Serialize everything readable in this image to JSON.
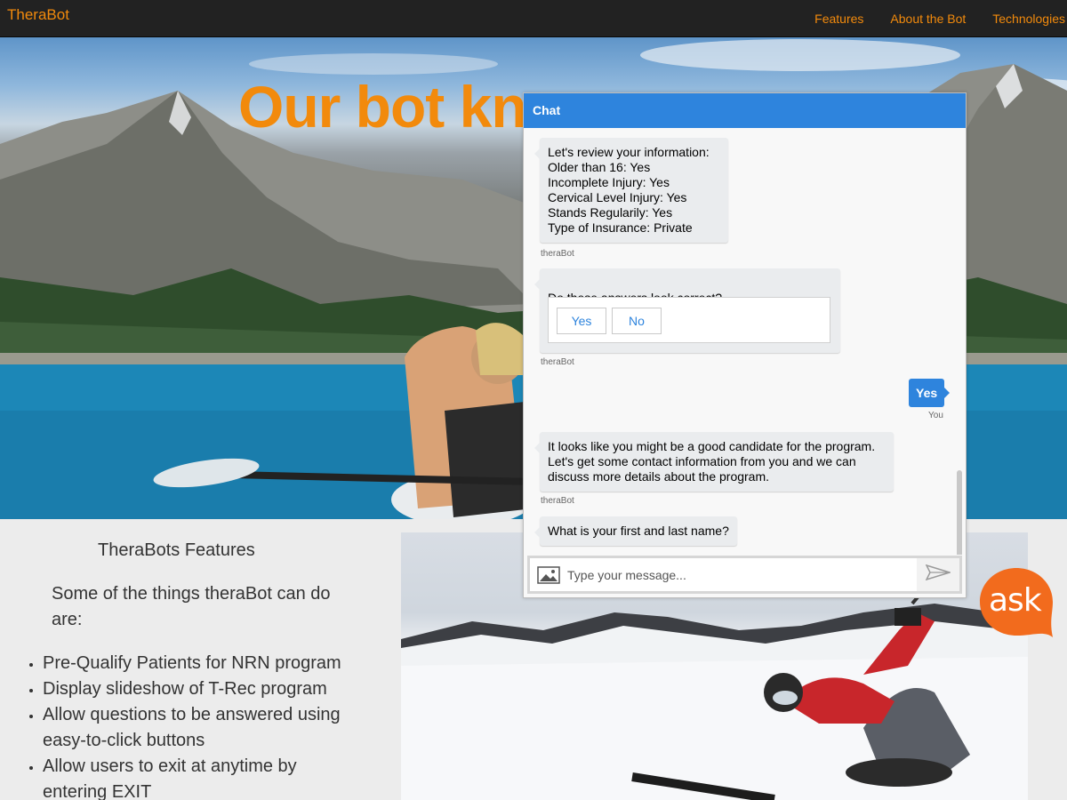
{
  "navbar": {
    "brand": "TheraBot",
    "links": [
      "Features",
      "About the Bot",
      "Technologies"
    ]
  },
  "hero": {
    "title": "Our bot kno"
  },
  "features": {
    "title": "TheraBots Features",
    "intro": "Some of the things theraBot can do are:",
    "items": [
      "Pre-Qualify Patients for NRN program",
      "Display slideshow of T-Rec program",
      "Allow questions to be answered using easy-to-click buttons",
      "Allow users to exit at anytime by entering EXIT"
    ]
  },
  "chat": {
    "header": "Chat",
    "messages": [
      {
        "from": "bot",
        "text": "Let's review your information:\nOlder than 16: Yes\nIncomplete Injury: Yes\nCervical Level Injury: Yes\nStands Regularily: Yes\nType of Insurance: Private",
        "sender": "theraBot"
      },
      {
        "from": "bot",
        "text": "Do these answers look correct?",
        "buttons": [
          "Yes",
          "No"
        ],
        "sender": "theraBot"
      },
      {
        "from": "user",
        "text": "Yes",
        "sender": "You"
      },
      {
        "from": "bot",
        "text": "It looks like you might be a good candidate for the program. Let's get some contact information from you and we can discuss more details about the program.",
        "sender": "theraBot"
      },
      {
        "from": "bot",
        "text": "What is your first and last name?"
      }
    ],
    "input_placeholder": "Type your message...",
    "icons": {
      "attach": "image-icon",
      "send": "send-icon"
    }
  },
  "ask_button": {
    "label": "ask",
    "color": "#f26b1d"
  },
  "colors": {
    "accent": "#f28a0c",
    "chat_header": "#2e84dd",
    "navbar": "#222222"
  }
}
